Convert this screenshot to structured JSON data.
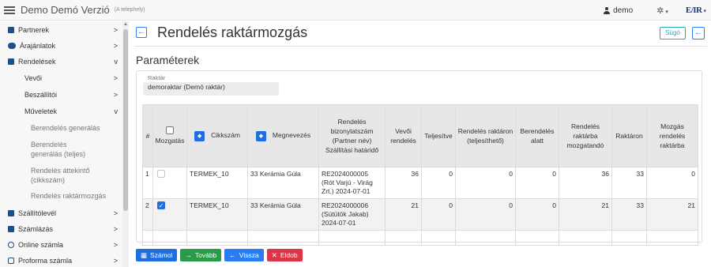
{
  "app": {
    "title": "Demo Demó Verzió",
    "subtitle": "(A telephely)",
    "user": "demo",
    "logo": "E/IR"
  },
  "sidebar": {
    "items": [
      {
        "label": "Partnerek",
        "icon": "address-book-icon",
        "arrow": ">"
      },
      {
        "label": "Árajánlatok",
        "icon": "people-icon",
        "arrow": ">"
      },
      {
        "label": "Rendelések",
        "icon": "document-icon",
        "arrow": "v"
      },
      {
        "label": "Vevői",
        "arrow": ">"
      },
      {
        "label": "Beszállítói",
        "arrow": ">"
      },
      {
        "label": "Műveletek",
        "arrow": "v"
      },
      {
        "label": "Berendelés generálás"
      },
      {
        "label": "Berendelés generálás (teljes)"
      },
      {
        "label": "Rendelés áttekintő (cikkszám)"
      },
      {
        "label": "Rendelés raktármozgás"
      },
      {
        "label": "Szállítólevél",
        "icon": "truck-icon",
        "arrow": ">"
      },
      {
        "label": "Számlázás",
        "icon": "document-icon",
        "arrow": ">"
      },
      {
        "label": "Online számla",
        "icon": "globe-icon",
        "arrow": ">"
      },
      {
        "label": "Proforma számla",
        "icon": "document-outline-icon",
        "arrow": ">"
      }
    ]
  },
  "page": {
    "title": "Rendelés raktármozgás",
    "help_label": "Súgó",
    "section_title": "Paraméterek",
    "warehouse_label": "Raktár",
    "warehouse_value": "demoraktar (Demó raktár)"
  },
  "table": {
    "headers": {
      "index": "#",
      "move": "Mozgatás",
      "item_no": "Cikkszám",
      "name": "Megnevezés",
      "order": "Rendelés bizonylatszám (Partner név) Szállítási határidő",
      "customer_order": "Vevői rendelés",
      "fulfilled": "Teljesítve",
      "order_in_stock": "Rendelés raktáron (teljesíthető)",
      "ordering": "Berendelés alatt",
      "to_move": "Rendelés raktárba mozgatandó",
      "in_stock": "Raktáron",
      "move_to_stock": "Mozgás rendelés raktárba"
    },
    "rows": [
      {
        "index": "1",
        "checked": false,
        "item_no": "TERMEK_10",
        "name": "33 Kerámia Gúla",
        "order": "RE2024000005 (Rót Varjú - Virág Zrt.) 2024-07-01",
        "customer_order": "36",
        "fulfilled": "0",
        "order_in_stock": "0",
        "ordering": "0",
        "to_move": "36",
        "in_stock": "33",
        "move_to_stock": "0"
      },
      {
        "index": "2",
        "checked": true,
        "item_no": "TERMEK_10",
        "name": "33 Kerámia Gúla",
        "order": "RE2024000006 (Sütütök Jakab) 2024-07-01",
        "customer_order": "21",
        "fulfilled": "0",
        "order_in_stock": "0",
        "ordering": "0",
        "to_move": "21",
        "in_stock": "33",
        "move_to_stock": "21"
      }
    ]
  },
  "actions": {
    "calculate": "Számol",
    "next": "Tovább",
    "back": "Vissza",
    "discard": "Eldob"
  }
}
